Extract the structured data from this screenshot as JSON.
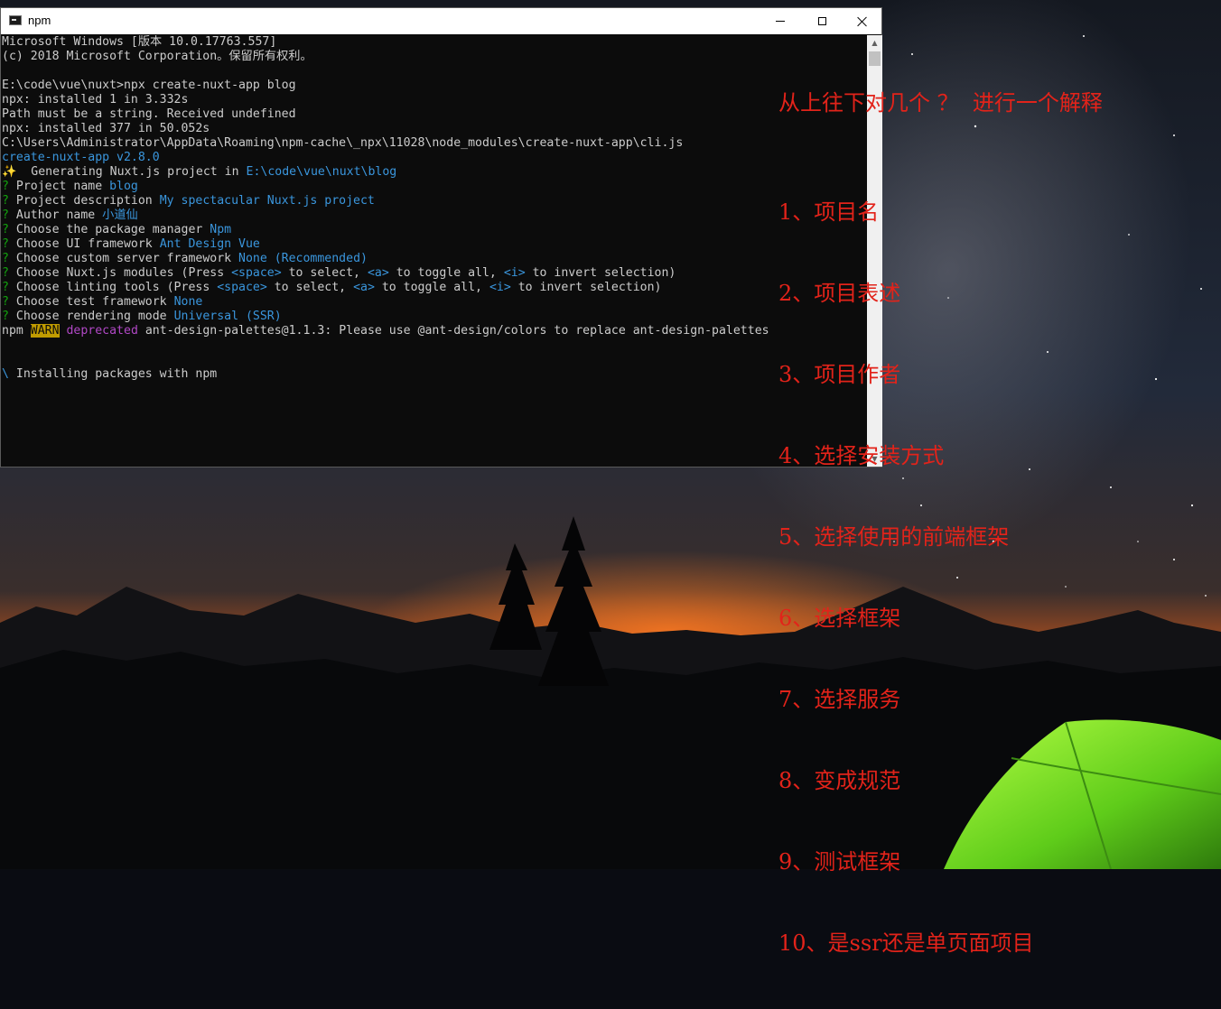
{
  "window": {
    "title": "npm",
    "icon": "console-icon",
    "controls": {
      "minimize": "minimize-icon",
      "maximize": "maximize-icon",
      "close": "close-icon"
    }
  },
  "console": {
    "lines": [
      [
        {
          "text": "Microsoft Windows [版本 10.0.17763.557]"
        }
      ],
      [
        {
          "text": "(c) 2018 Microsoft Corporation。保留所有权利。"
        }
      ],
      [
        {
          "text": ""
        }
      ],
      [
        {
          "text": "E:\\code\\vue\\nuxt>npx create-nuxt-app blog"
        }
      ],
      [
        {
          "text": "npx: installed 1 in 3.332s"
        }
      ],
      [
        {
          "text": "Path must be a string. Received undefined"
        }
      ],
      [
        {
          "text": "npx: installed 377 in 50.052s"
        }
      ],
      [
        {
          "text": "C:\\Users\\Administrator\\AppData\\Roaming\\npm-cache\\_npx\\11028\\node_modules\\create-nuxt-app\\cli.js"
        }
      ],
      [
        {
          "text": "create-nuxt-app v2.8.0",
          "c": "c-blue"
        }
      ],
      [
        {
          "text": "✨  Generating Nuxt.js project in "
        },
        {
          "text": "E:\\code\\vue\\nuxt\\blog",
          "c": "c-blue"
        }
      ],
      [
        {
          "text": "? ",
          "c": "c-green"
        },
        {
          "text": "Project name "
        },
        {
          "text": "blog",
          "c": "c-blue"
        }
      ],
      [
        {
          "text": "? ",
          "c": "c-green"
        },
        {
          "text": "Project description "
        },
        {
          "text": "My spectacular Nuxt.js project",
          "c": "c-blue"
        }
      ],
      [
        {
          "text": "? ",
          "c": "c-green"
        },
        {
          "text": "Author name "
        },
        {
          "text": "小道仙",
          "c": "c-blue"
        }
      ],
      [
        {
          "text": "? ",
          "c": "c-green"
        },
        {
          "text": "Choose the package manager "
        },
        {
          "text": "Npm",
          "c": "c-blue"
        }
      ],
      [
        {
          "text": "? ",
          "c": "c-green"
        },
        {
          "text": "Choose UI framework "
        },
        {
          "text": "Ant Design Vue",
          "c": "c-blue"
        }
      ],
      [
        {
          "text": "? ",
          "c": "c-green"
        },
        {
          "text": "Choose custom server framework "
        },
        {
          "text": "None (Recommended)",
          "c": "c-blue"
        }
      ],
      [
        {
          "text": "? ",
          "c": "c-green"
        },
        {
          "text": "Choose Nuxt.js modules (Press "
        },
        {
          "text": "<space>",
          "c": "c-blue"
        },
        {
          "text": " to select, "
        },
        {
          "text": "<a>",
          "c": "c-blue"
        },
        {
          "text": " to toggle all, "
        },
        {
          "text": "<i>",
          "c": "c-blue"
        },
        {
          "text": " to invert selection)"
        }
      ],
      [
        {
          "text": "? ",
          "c": "c-green"
        },
        {
          "text": "Choose linting tools (Press "
        },
        {
          "text": "<space>",
          "c": "c-blue"
        },
        {
          "text": " to select, "
        },
        {
          "text": "<a>",
          "c": "c-blue"
        },
        {
          "text": " to toggle all, "
        },
        {
          "text": "<i>",
          "c": "c-blue"
        },
        {
          "text": " to invert selection)"
        }
      ],
      [
        {
          "text": "? ",
          "c": "c-green"
        },
        {
          "text": "Choose test framework "
        },
        {
          "text": "None",
          "c": "c-blue"
        }
      ],
      [
        {
          "text": "? ",
          "c": "c-green"
        },
        {
          "text": "Choose rendering mode "
        },
        {
          "text": "Universal (SSR)",
          "c": "c-blue"
        }
      ],
      [
        {
          "text": "npm "
        },
        {
          "text": "WARN",
          "c": "c-warn"
        },
        {
          "text": " "
        },
        {
          "text": "deprecated",
          "c": "c-magenta"
        },
        {
          "text": " ant-design-palettes@1.1.3: Please use @ant-design/colors to replace ant-design-palettes"
        }
      ],
      [
        {
          "text": ""
        }
      ],
      [
        {
          "text": ""
        }
      ],
      [
        {
          "text": "\\ ",
          "c": "c-blue"
        },
        {
          "text": "Installing packages with npm"
        }
      ]
    ]
  },
  "scrollbar": {
    "up_arrow": "▲",
    "down_arrow": "▼"
  },
  "annotation": {
    "heading": "从上往下对几个 ？  进行一个解释",
    "items": [
      "1、项目名",
      "2、项目表述",
      "3、项目作者",
      "4、选择安装方式",
      "5、选择使用的前端框架",
      "6、选择框架",
      "7、选择服务",
      "8、变成规范",
      "9、测试框架",
      "10、是ssr还是单页面项目"
    ]
  }
}
